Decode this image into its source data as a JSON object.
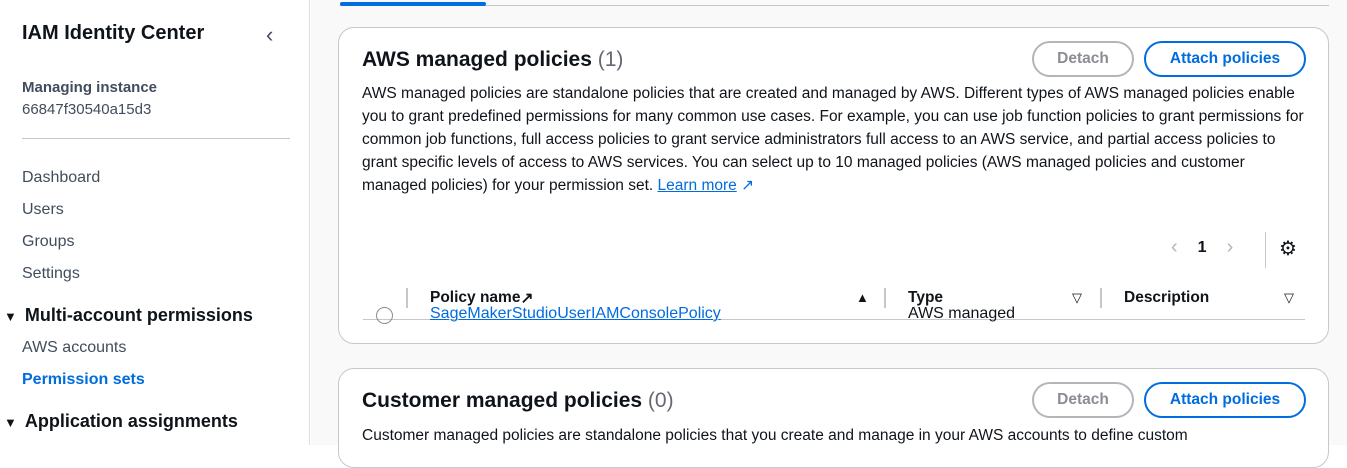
{
  "sidebar": {
    "title": "IAM Identity Center",
    "collapse_icon": "chevron-left-icon",
    "instance_label": "Managing instance",
    "instance_id": "66847f30540a15d3",
    "items": [
      {
        "label": "Dashboard"
      },
      {
        "label": "Users"
      },
      {
        "label": "Groups"
      },
      {
        "label": "Settings"
      }
    ],
    "sections": [
      {
        "label": "Multi-account permissions",
        "items": [
          {
            "label": "AWS accounts"
          },
          {
            "label": "Permission sets",
            "active": true
          }
        ]
      },
      {
        "label": "Application assignments"
      }
    ]
  },
  "aws_policies": {
    "title": "AWS managed policies",
    "count": "(1)",
    "detach": "Detach",
    "attach": "Attach policies",
    "description": "AWS managed policies are standalone policies that are created and managed by AWS. Different types of AWS managed policies enable you to grant predefined permissions for many common use cases. For example, you can use job function policies to grant permissions for common job functions, full access policies to grant service administrators full access to an AWS service, and partial access policies to grant specific levels of access to AWS services. You can select up to 10 managed policies (AWS managed policies and customer managed policies) for your permission set.",
    "learn_more": "Learn more",
    "page": "1",
    "columns": [
      "Policy name",
      "Type",
      "Description"
    ],
    "rows": [
      {
        "name": "SageMakerStudioUserIAMConsolePolicy",
        "type": "AWS managed",
        "description": ""
      }
    ]
  },
  "customer_policies": {
    "title": "Customer managed policies",
    "count": "(0)",
    "detach": "Detach",
    "attach": "Attach policies",
    "description": "Customer managed policies are standalone policies that you create and manage in your AWS accounts to define custom"
  },
  "colors": {
    "accent": "#006ce0"
  }
}
